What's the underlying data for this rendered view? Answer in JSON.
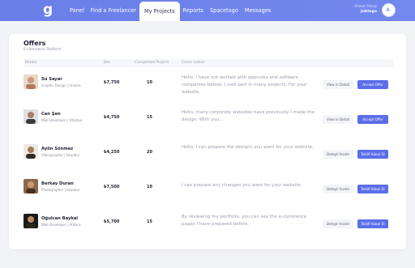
{
  "header": {
    "logo": "g",
    "nav": [
      "Panel",
      "Find a Freelancer",
      "My Projects",
      "Reports",
      "Spacetogo",
      "Messages"
    ],
    "active_nav": "My Projects",
    "user_name": "Ahmet Yılmaz",
    "user_company": "Jobtogo",
    "avatar_initial": "A."
  },
  "offers": {
    "title": "Offers",
    "subtitle": "E-commerce Platform",
    "columns": [
      "Bidder",
      "Bid",
      "Completed Project",
      "Cover Letter"
    ],
    "rows": [
      {
        "name": "Su Sayar",
        "role": "Graphic Design | Ankara",
        "bid": "₺7,750",
        "projects": "10",
        "letter": "Hello, I have not worked with agencies and software companies before. I look part in many projects. For your website.",
        "detail": "View in Detail",
        "accept": "Accept Offer",
        "photo_color": "#c79a7a"
      },
      {
        "name": "Can Şen",
        "role": "Web Developer | İstanbul",
        "bid": "₺4,750",
        "projects": "15",
        "letter": "Hello, many corporate websites have previously I made the design. With you...",
        "detail": "View in Detail",
        "accept": "Accept Offer",
        "photo_color": "#3a3a3a"
      },
      {
        "name": "Aylin Sönmez",
        "role": "Videographer | İstanbul",
        "bid": "₺4,250",
        "projects": "20",
        "letter": "Hello, I can prepare the designs you want for your website.",
        "detail": "Detaylı İncele",
        "accept": "Teklifi Kabul Et",
        "photo_color": "#a07d5c"
      },
      {
        "name": "Berkay Duran",
        "role": "Photographer | İstanbul",
        "bid": "₺7,500",
        "projects": "10",
        "letter": "I can prepare any changes you want for your website.",
        "detail": "Detaylı İncele",
        "accept": "Teklifi Kabul Et",
        "photo_color": "#6a4a34"
      },
      {
        "name": "Oğulcan Baykal",
        "role": "Web Developer | Ankara",
        "bid": "₺5,700",
        "projects": "15",
        "letter": "By reviewing my portfolio, you can see the e-commerce pages I have prepared before.",
        "detail": "Detaylı İncele",
        "accept": "Teklifi Kabul Et",
        "photo_color": "#2b2620"
      }
    ]
  },
  "colors": {
    "header": "#6a7ee8",
    "accent": "#5b6ee8",
    "background": "#f2f3f7"
  }
}
